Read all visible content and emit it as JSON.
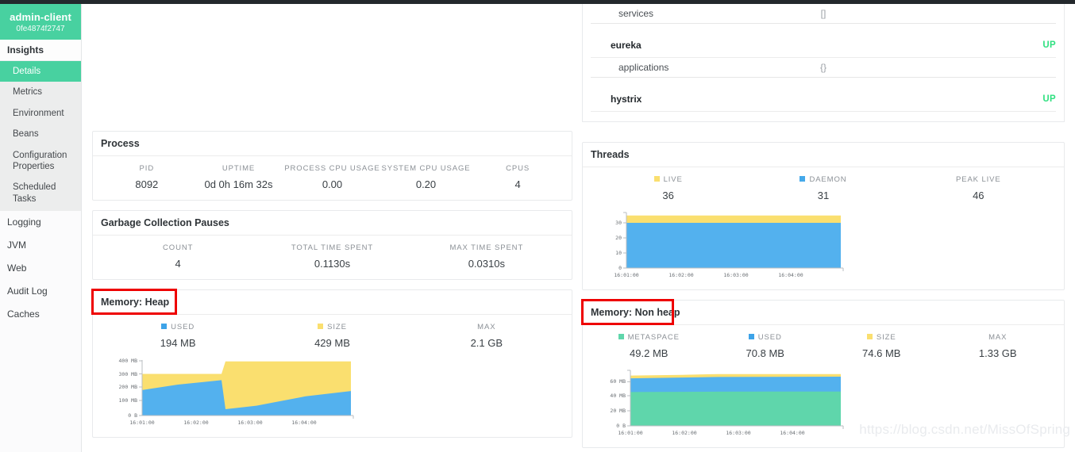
{
  "brand": {
    "title": "admin-client",
    "instance": "0fe4874f2747"
  },
  "sidebar": {
    "section": {
      "label": "Insights"
    },
    "sub_items": [
      {
        "label": "Details",
        "active": true
      },
      {
        "label": "Metrics",
        "active": false
      },
      {
        "label": "Environment",
        "active": false
      },
      {
        "label": "Beans",
        "active": false
      },
      {
        "label": "Configuration Properties",
        "active": false
      },
      {
        "label": "Scheduled Tasks",
        "active": false
      }
    ],
    "root_items": [
      {
        "label": "Logging"
      },
      {
        "label": "JVM"
      },
      {
        "label": "Web"
      },
      {
        "label": "Audit Log"
      },
      {
        "label": "Caches"
      }
    ]
  },
  "health": {
    "rows": [
      {
        "name": "services",
        "value": "[]",
        "type": "child"
      },
      {
        "name": "eureka",
        "status": "UP",
        "type": "group"
      },
      {
        "name": "applications",
        "value": "{}",
        "type": "child"
      },
      {
        "name": "hystrix",
        "status": "UP",
        "type": "group"
      }
    ]
  },
  "process": {
    "title": "Process",
    "stats": [
      {
        "label": "PID",
        "value": "8092"
      },
      {
        "label": "UPTIME",
        "value": "0d 0h 16m 32s"
      },
      {
        "label": "PROCESS CPU USAGE",
        "value": "0.00"
      },
      {
        "label": "SYSTEM CPU USAGE",
        "value": "0.20"
      },
      {
        "label": "CPUS",
        "value": "4"
      }
    ]
  },
  "gc": {
    "title": "Garbage Collection Pauses",
    "stats": [
      {
        "label": "COUNT",
        "value": "4"
      },
      {
        "label": "TOTAL TIME SPENT",
        "value": "0.1130s"
      },
      {
        "label": "MAX TIME SPENT",
        "value": "0.0310s"
      }
    ]
  },
  "threads": {
    "title": "Threads",
    "stats": [
      {
        "label": "LIVE",
        "value": "36",
        "color": "#fadf6f"
      },
      {
        "label": "DAEMON",
        "value": "31",
        "color": "#45a9ea"
      },
      {
        "label": "PEAK LIVE",
        "value": "46",
        "color": null
      }
    ]
  },
  "heap": {
    "title": "Memory: Heap",
    "highlighted": true,
    "stats": [
      {
        "label": "USED",
        "value": "194 MB",
        "color": "#3da3e8"
      },
      {
        "label": "SIZE",
        "value": "429 MB",
        "color": "#fadf6f"
      },
      {
        "label": "MAX",
        "value": "2.1 GB",
        "color": null
      }
    ]
  },
  "nonheap": {
    "title": "Memory: Non heap",
    "highlighted": true,
    "stats": [
      {
        "label": "METASPACE",
        "value": "49.2 MB",
        "color": "#5fd6ab"
      },
      {
        "label": "USED",
        "value": "70.8 MB",
        "color": "#3da3e8"
      },
      {
        "label": "SIZE",
        "value": "74.6 MB",
        "color": "#fadf6f"
      },
      {
        "label": "MAX",
        "value": "1.33 GB",
        "color": null
      }
    ]
  },
  "watermark": "https://blog.csdn.net/MissOfSpring",
  "colors": {
    "brand_green": "#48d1a0",
    "status_up": "#2fe080",
    "series_yellow": "#fadf6f",
    "series_blue": "#53b1ee",
    "series_green": "#5fd6ab",
    "annotation_red": "#ee0000"
  },
  "chart_data": [
    {
      "type": "area",
      "name": "threads-chart",
      "title": "Threads",
      "stacked": true,
      "x": [
        "16:01:00",
        "16:01:50",
        "16:02:40",
        "16:03:30",
        "16:04:20",
        "16:04:45"
      ],
      "xticks": [
        "16:01:00",
        "16:02:00",
        "16:03:00",
        "16:04:00"
      ],
      "yticks": [
        0,
        10,
        20,
        30
      ],
      "ylim": [
        0,
        38
      ],
      "ylabel": "",
      "xlabel": "",
      "grid": false,
      "legend": "top",
      "series": [
        {
          "name": "DAEMON",
          "color": "#53b1ee",
          "values": [
            31,
            31,
            31,
            31,
            31,
            31
          ]
        },
        {
          "name": "LIVE",
          "color": "#fadf6f",
          "values": [
            36,
            36,
            36,
            36,
            36,
            36
          ]
        }
      ]
    },
    {
      "type": "area",
      "name": "heap-chart",
      "title": "Memory: Heap",
      "stacked": false,
      "x": [
        "16:01:00",
        "16:01:40",
        "16:02:20",
        "16:02:25",
        "16:03:00",
        "16:04:00",
        "16:04:45"
      ],
      "xticks": [
        "16:01:00",
        "16:02:00",
        "16:03:00",
        "16:04:00"
      ],
      "yticks": [
        "0 B",
        "100 MB",
        "200 MB",
        "300 MB",
        "400 MB"
      ],
      "ylim": [
        0,
        440
      ],
      "ylabel": "",
      "xlabel": "",
      "grid": false,
      "legend": "top",
      "series": [
        {
          "name": "SIZE",
          "color": "#fadf6f",
          "values": [
            330,
            330,
            330,
            429,
            429,
            429,
            429
          ]
        },
        {
          "name": "USED",
          "color": "#53b1ee",
          "values": [
            202,
            245,
            280,
            50,
            78,
            152,
            194
          ]
        }
      ]
    },
    {
      "type": "area",
      "name": "nonheap-chart",
      "title": "Memory: Non heap",
      "stacked": false,
      "x": [
        "16:01:00",
        "16:02:00",
        "16:02:40",
        "16:03:30",
        "16:04:45"
      ],
      "xticks": [
        "16:01:00",
        "16:02:00",
        "16:03:00",
        "16:04:00"
      ],
      "yticks": [
        "0 B",
        "20 MB",
        "40 MB",
        "60 MB"
      ],
      "ylim": [
        0,
        80
      ],
      "ylabel": "",
      "xlabel": "",
      "grid": false,
      "legend": "top",
      "series": [
        {
          "name": "SIZE",
          "color": "#fadf6f",
          "values": [
            72.5,
            73.4,
            74.6,
            74.6,
            74.6
          ]
        },
        {
          "name": "USED",
          "color": "#53b1ee",
          "values": [
            68.5,
            69.6,
            70.4,
            70.6,
            70.8
          ]
        },
        {
          "name": "METASPACE",
          "color": "#5fd6ab",
          "values": [
            48.6,
            48.9,
            49.1,
            49.2,
            49.2
          ]
        }
      ]
    }
  ]
}
